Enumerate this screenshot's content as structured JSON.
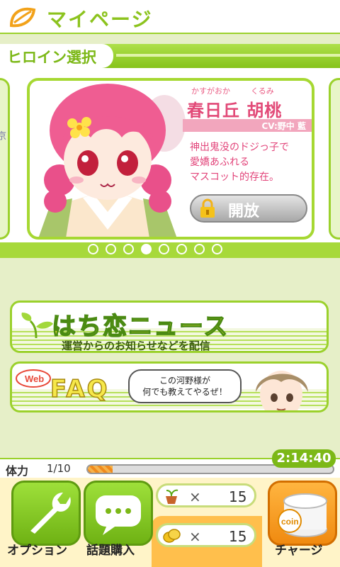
{
  "header": {
    "title": "マイページ"
  },
  "section": {
    "title": "ヒロイン選択"
  },
  "carousel": {
    "peek_left_text": "京",
    "card": {
      "ruby_family": "かすがおか",
      "ruby_given": "くるみ",
      "name": "春日丘 胡桃",
      "cv": "CV:野中 藍",
      "description": "神出鬼没のドジっ子で\n愛嬌あふれる\nマスコット的存在。",
      "unlock_label": "開放"
    },
    "page_count": 8,
    "active_page": 4
  },
  "news": {
    "title": "はち恋ニュース",
    "subtitle": "運営からのお知らせなどを配信"
  },
  "faq": {
    "badge": "Web",
    "title": "FAQ",
    "bubble": "この河野様が\n何でも教えてやるぜ！"
  },
  "stamina": {
    "label": "体力",
    "value": "1/10",
    "fraction": 0.1
  },
  "timer": "2:14:40",
  "footer": {
    "option_label": "オプション",
    "topic_label": "話題購入",
    "charge_label": "チャージ",
    "plant_x": "×",
    "plant_count": "15",
    "coin_x": "×",
    "coin_count": "15",
    "coin_text": "coin"
  }
}
